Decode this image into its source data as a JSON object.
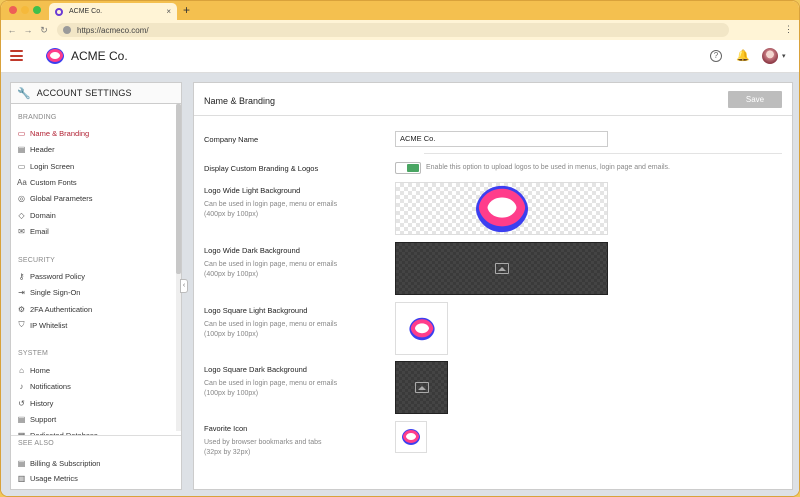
{
  "browser": {
    "tab_title": "ACME Co.",
    "new_tab": "+",
    "tab_close": "×",
    "url": "https://acmeco.com/",
    "back": "←",
    "forward": "→",
    "reload": "↻",
    "menu": "⋮"
  },
  "header": {
    "brand": "ACME Co.",
    "help": "?",
    "bell": "🔔",
    "caret": "▾"
  },
  "sidebar": {
    "title": "ACCOUNT SETTINGS",
    "wrench": "🔧",
    "collapse": "‹",
    "sections": [
      {
        "label": "BRANDING"
      },
      {
        "label": "SECURITY"
      },
      {
        "label": "SYSTEM"
      },
      {
        "label": "SEE ALSO"
      }
    ],
    "branding_items": [
      {
        "label": "Name & Branding",
        "icon": "id-card-icon",
        "glyph": "▭"
      },
      {
        "label": "Header",
        "icon": "header-icon",
        "glyph": "▤"
      },
      {
        "label": "Login Screen",
        "icon": "laptop-icon",
        "glyph": "▭"
      },
      {
        "label": "Custom Fonts",
        "icon": "font-icon",
        "glyph": "Aa"
      },
      {
        "label": "Global Parameters",
        "icon": "globe-icon",
        "glyph": "◎"
      },
      {
        "label": "Domain",
        "icon": "tag-icon",
        "glyph": "◇"
      },
      {
        "label": "Email",
        "icon": "envelope-icon",
        "glyph": "✉"
      }
    ],
    "security_items": [
      {
        "label": "Password Policy",
        "icon": "key-icon",
        "glyph": "⚷"
      },
      {
        "label": "Single Sign-On",
        "icon": "login-icon",
        "glyph": "⇥"
      },
      {
        "label": "2FA Authentication",
        "icon": "settings-cog-icon",
        "glyph": "⚙"
      },
      {
        "label": "IP Whitelist",
        "icon": "shield-icon",
        "glyph": "⛉"
      }
    ],
    "system_items": [
      {
        "label": "Home",
        "icon": "home-icon",
        "glyph": "⌂"
      },
      {
        "label": "Notifications",
        "icon": "bell-icon",
        "glyph": "♪"
      },
      {
        "label": "History",
        "icon": "history-icon",
        "glyph": "↺"
      },
      {
        "label": "Support",
        "icon": "document-icon",
        "glyph": "▤"
      },
      {
        "label": "Dedicated Database",
        "icon": "database-icon",
        "glyph": "▦"
      }
    ],
    "seealso_items": [
      {
        "label": "Billing & Subscription",
        "icon": "receipt-icon",
        "glyph": "▤"
      },
      {
        "label": "Usage Metrics",
        "icon": "metrics-icon",
        "glyph": "▥"
      }
    ]
  },
  "panel": {
    "title": "Name & Branding",
    "save_label": "Save",
    "company_name_label": "Company Name",
    "company_name_value": "ACME Co.",
    "custom_branding_label": "Display Custom Branding & Logos",
    "custom_branding_hint": "Enable this option to upload logos to be used in menus, login page and emails.",
    "custom_branding_enabled": true,
    "logos": [
      {
        "title": "Logo Wide Light Background",
        "desc1": "Can be used in login page, menu or emails",
        "desc2": "(400px by 100px)"
      },
      {
        "title": "Logo Wide Dark Background",
        "desc1": "Can be used in login page, menu or emails",
        "desc2": "(400px by 100px)"
      },
      {
        "title": "Logo Square Light Background",
        "desc1": "Can be used in login page, menu or emails",
        "desc2": "(100px by 100px)"
      },
      {
        "title": "Logo Square Dark Background",
        "desc1": "Can be used in login page, menu or emails",
        "desc2": "(100px by 100px)"
      },
      {
        "title": "Favorite Icon",
        "desc1": "Used by browser bookmarks and tabs",
        "desc2": "(32px by 32px)"
      }
    ]
  },
  "colors": {
    "accent": "#b22234",
    "toggle_on": "#49a562",
    "logo_pink": "#ff3d8b",
    "logo_blue": "#3b3ff0"
  }
}
